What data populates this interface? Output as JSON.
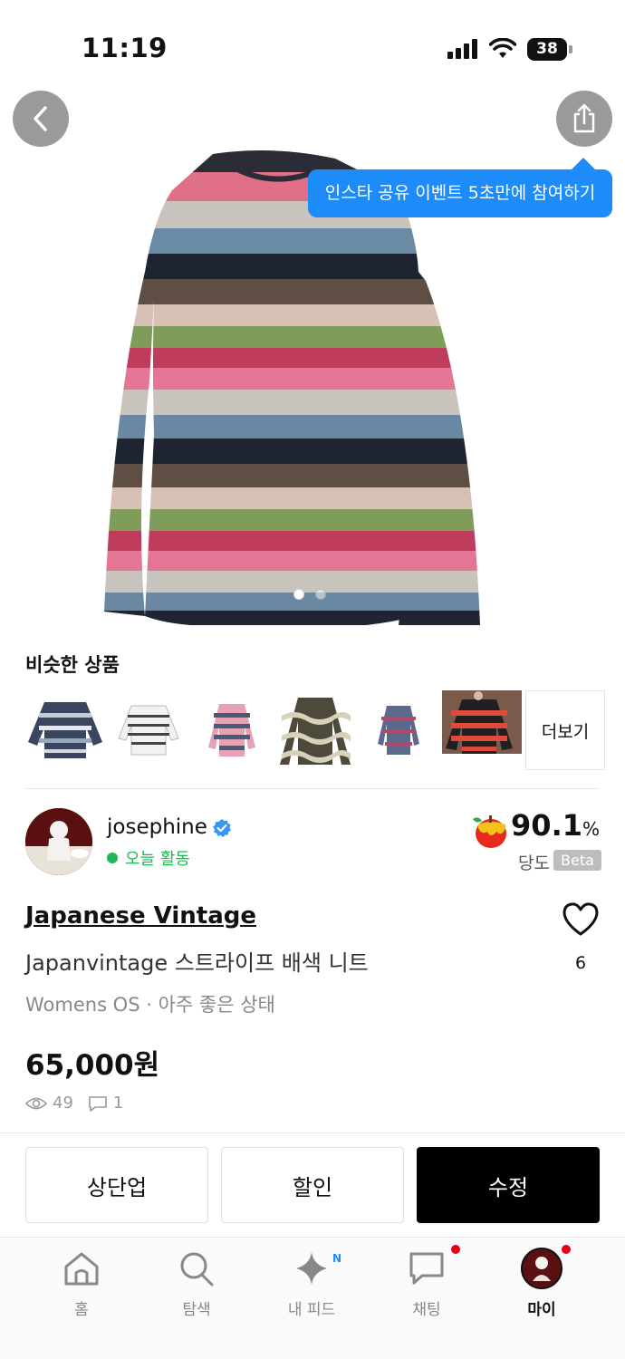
{
  "status_bar": {
    "time": "11:19",
    "battery": "38"
  },
  "product_image": {
    "tooltip": "인스타 공유 이벤트 5초만에 참여하기",
    "page_count": 2,
    "current_page": 1
  },
  "similar": {
    "title": "비슷한 상품",
    "more_label": "더보기"
  },
  "seller": {
    "name": "josephine",
    "activity": "오늘 활동",
    "rating": "90.1",
    "rating_unit": "%",
    "rating_label": "당도",
    "rating_badge": "Beta"
  },
  "product": {
    "brand": "Japanese Vintage",
    "name": "Japanvintage 스트라이프 배색 니트",
    "meta": "Womens OS · 아주 좋은 상태",
    "price": "65,000원",
    "views": "49",
    "comments": "1",
    "likes": "6"
  },
  "actions": {
    "bump": "상단업",
    "discount": "할인",
    "edit": "수정"
  },
  "nav": {
    "home": "홈",
    "explore": "탐색",
    "feed": "내 피드",
    "feed_badge": "N",
    "chat": "채팅",
    "my": "마이"
  },
  "colors": {
    "accent_blue": "#1d8cf8",
    "verified_blue": "#3897f0",
    "active_green": "#1db954",
    "notification_red": "#e60012"
  },
  "icons": [
    "back-arrow-icon",
    "share-icon",
    "verified-icon",
    "apple-icon",
    "heart-icon",
    "eye-icon",
    "comment-icon",
    "home-icon",
    "search-icon",
    "sparkle-icon",
    "chat-icon",
    "profile-icon"
  ]
}
